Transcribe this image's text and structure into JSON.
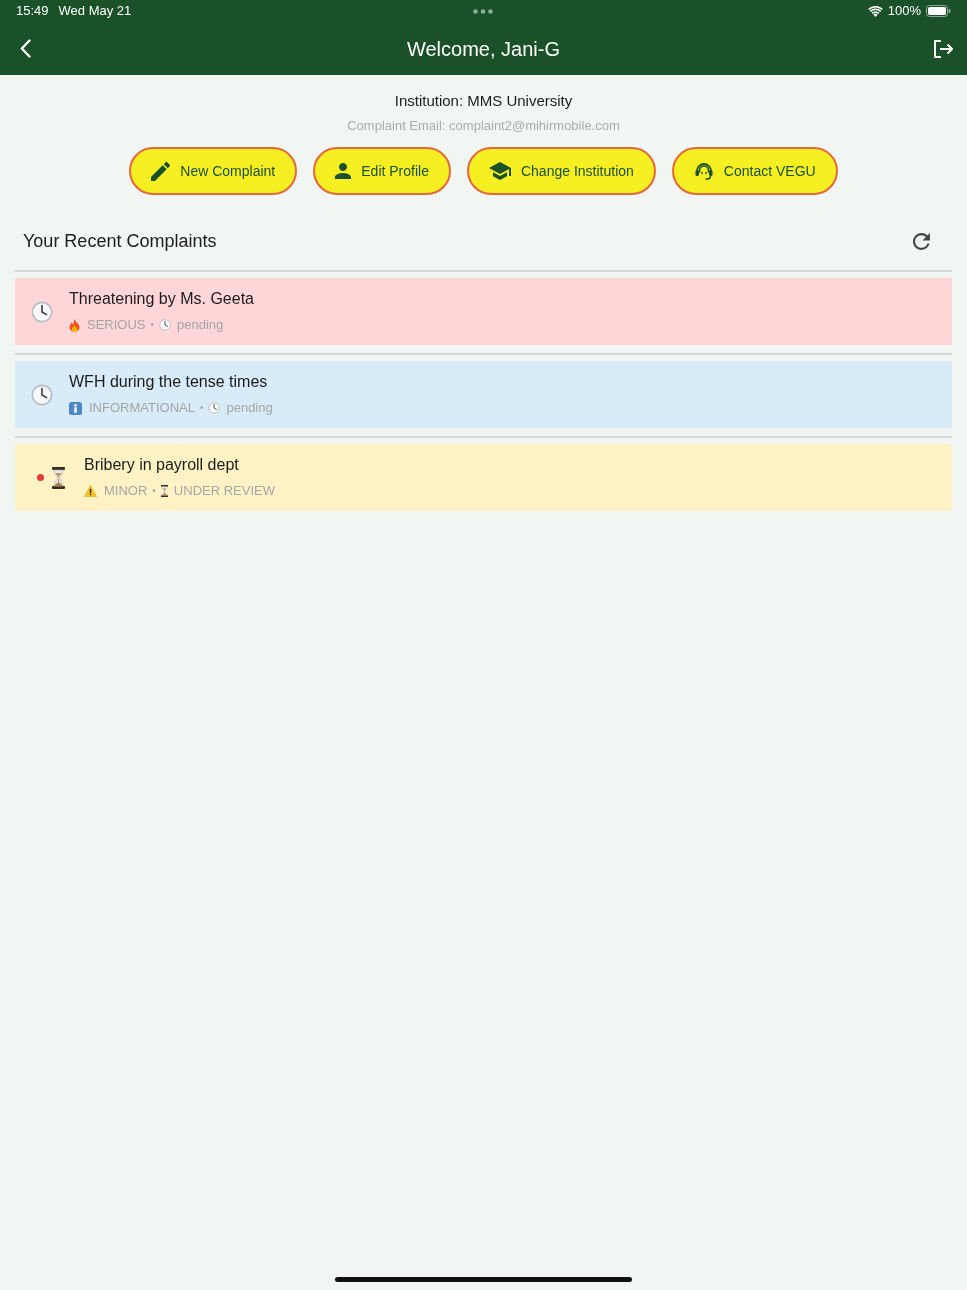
{
  "status_bar": {
    "time": "15:49",
    "date": "Wed May 21",
    "battery": "100%"
  },
  "header": {
    "title": "Welcome, Jani-G"
  },
  "institution": {
    "name": "Institution: MMS University",
    "email": "Complaint Email: complaint2@mihirmobile.com"
  },
  "actions": [
    {
      "kind": "pencil",
      "label": "New Complaint"
    },
    {
      "kind": "person",
      "label": "Edit Profile"
    },
    {
      "kind": "cap",
      "label": "Change Institution"
    },
    {
      "kind": "headset",
      "label": "Contact VEGU"
    }
  ],
  "recent": {
    "title": "Your Recent Complaints"
  },
  "complaints": [
    {
      "title": "Threatening by Ms. Geeta",
      "unread": false,
      "severity": {
        "kind": "serious",
        "label": "SERIOUS"
      },
      "separator": "•",
      "status": {
        "kind": "pending",
        "label": "pending"
      }
    },
    {
      "title": "WFH during the tense times",
      "unread": false,
      "severity": {
        "kind": "informational",
        "label": "INFORMATIONAL"
      },
      "separator": "•",
      "status": {
        "kind": "pending",
        "label": "pending"
      }
    },
    {
      "title": "Bribery in payroll dept",
      "unread": true,
      "severity": {
        "kind": "minor",
        "label": "MINOR"
      },
      "separator": "•",
      "status": {
        "kind": "review",
        "label": "UNDER REVIEW"
      }
    }
  ]
}
